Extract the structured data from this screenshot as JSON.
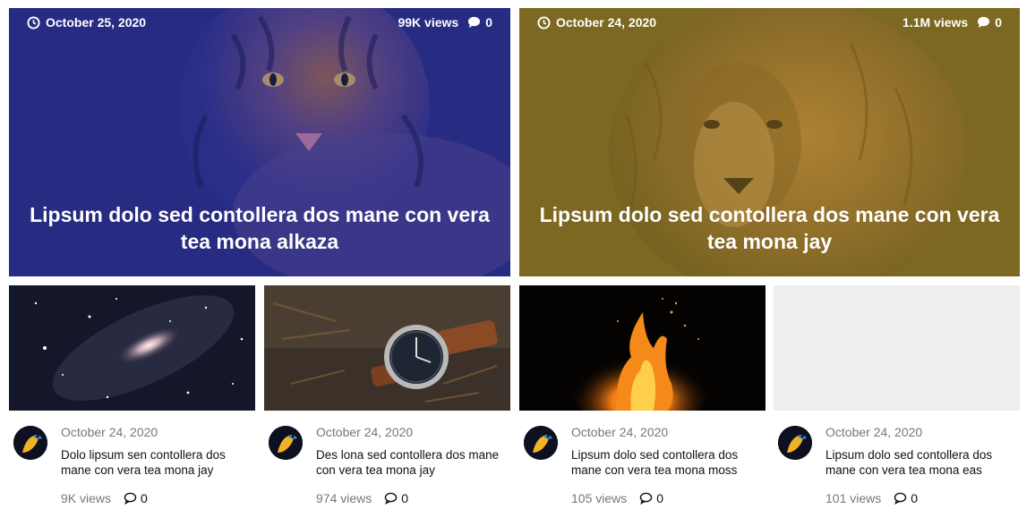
{
  "featured": [
    {
      "date": "October 25, 2020",
      "views": "99K views",
      "comments": "0",
      "title": "Lipsum dolo sed contollera dos mane con vera tea mona alkaza",
      "overlay": "#2b2f8f",
      "image": "tiger"
    },
    {
      "date": "October 24, 2020",
      "views": "1.1M views",
      "comments": "0",
      "title": "Lipsum dolo sed contollera dos mane con vera tea mona jay",
      "overlay": "#8a7424",
      "image": "lion"
    }
  ],
  "cards": [
    {
      "image": "galaxy",
      "date": "October 24, 2020",
      "title": "Dolo lipsum sen contollera dos mane con vera tea mona jay",
      "views": "9K views",
      "comments": "0"
    },
    {
      "image": "wristwatch",
      "date": "October 24, 2020",
      "title": "Des lona sed contollera dos mane con vera tea mona jay",
      "views": "974 views",
      "comments": "0"
    },
    {
      "image": "campfire",
      "date": "October 24, 2020",
      "title": "Lipsum dolo sed contollera dos mane con vera tea mona moss",
      "views": "105 views",
      "comments": "0"
    },
    {
      "image": "placeholder",
      "date": "October 24, 2020",
      "title": "Lipsum dolo sed contollera dos mane con vera tea mona eas",
      "views": "101 views",
      "comments": "0"
    }
  ],
  "icons": {
    "date": "clock-icon",
    "comments": "comment-bubble-icon",
    "author": "bird-avatar"
  }
}
